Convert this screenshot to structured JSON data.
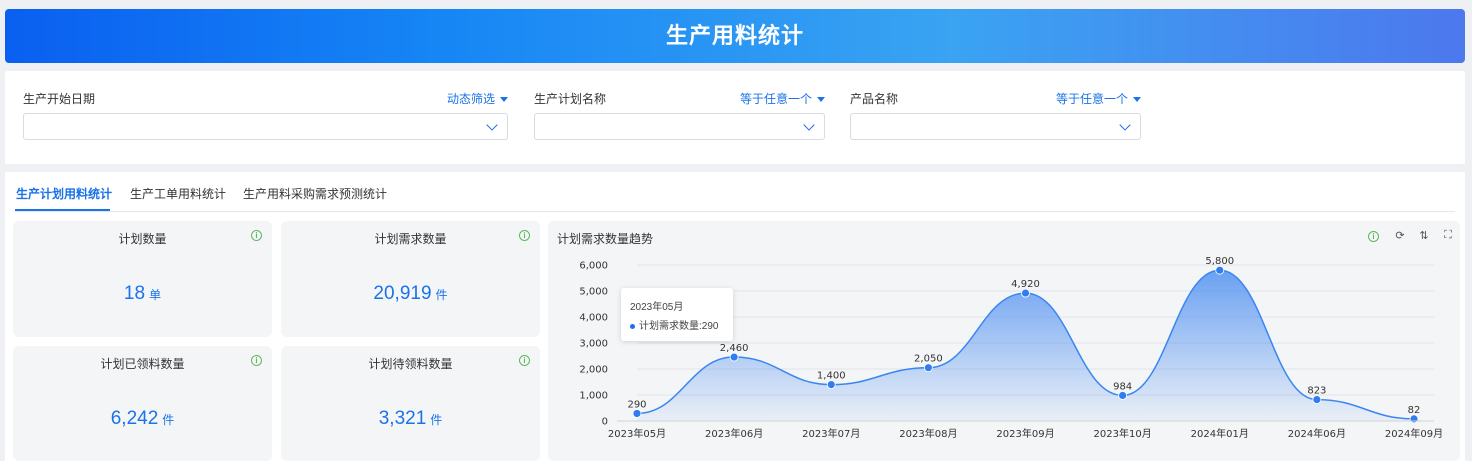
{
  "header": {
    "title": "生产用料统计"
  },
  "filters": [
    {
      "label": "生产开始日期",
      "mode": "动态筛选"
    },
    {
      "label": "生产计划名称",
      "mode": "等于任意一个"
    },
    {
      "label": "产品名称",
      "mode": "等于任意一个"
    }
  ],
  "tabs": [
    {
      "label": "生产计划用料统计",
      "active": true
    },
    {
      "label": "生产工单用料统计",
      "active": false
    },
    {
      "label": "生产用料采购需求预测统计",
      "active": false
    }
  ],
  "cards": [
    {
      "title": "计划数量",
      "value": "18",
      "unit": "单"
    },
    {
      "title": "计划需求数量",
      "value": "20,919",
      "unit": "件"
    },
    {
      "title": "计划已领料数量",
      "value": "6,242",
      "unit": "件"
    },
    {
      "title": "计划待领料数量",
      "value": "3,321",
      "unit": "件"
    }
  ],
  "chart_panel": {
    "title": "计划需求数量趋势"
  },
  "tooltip": {
    "title": "2023年05月",
    "row": "计划需求数量:290"
  },
  "colors": {
    "accent": "#1a73e8",
    "info": "#5cb85c"
  },
  "chart_data": {
    "type": "area",
    "title": "",
    "xlabel": "",
    "ylabel": "",
    "categories": [
      "2023年05月",
      "2023年06月",
      "2023年07月",
      "2023年08月",
      "2023年09月",
      "2023年10月",
      "2024年01月",
      "2024年06月",
      "2024年09月"
    ],
    "series": [
      {
        "values": [
          290,
          2460,
          1400,
          2050,
          4920,
          984,
          5800,
          823,
          82
        ],
        "labels": [
          "290",
          "2,460",
          "1,400",
          "2,050",
          "4,920",
          "984",
          "5,800",
          "823",
          "82"
        ]
      }
    ],
    "ylim": [
      0,
      6000
    ],
    "yticks": [
      0,
      1000,
      2000,
      3000,
      4000,
      5000,
      6000
    ],
    "ytick_labels": [
      "0",
      "1,000",
      "2,000",
      "3,000",
      "4,000",
      "5,000",
      "6,000"
    ],
    "grid": true,
    "smooth": true
  }
}
